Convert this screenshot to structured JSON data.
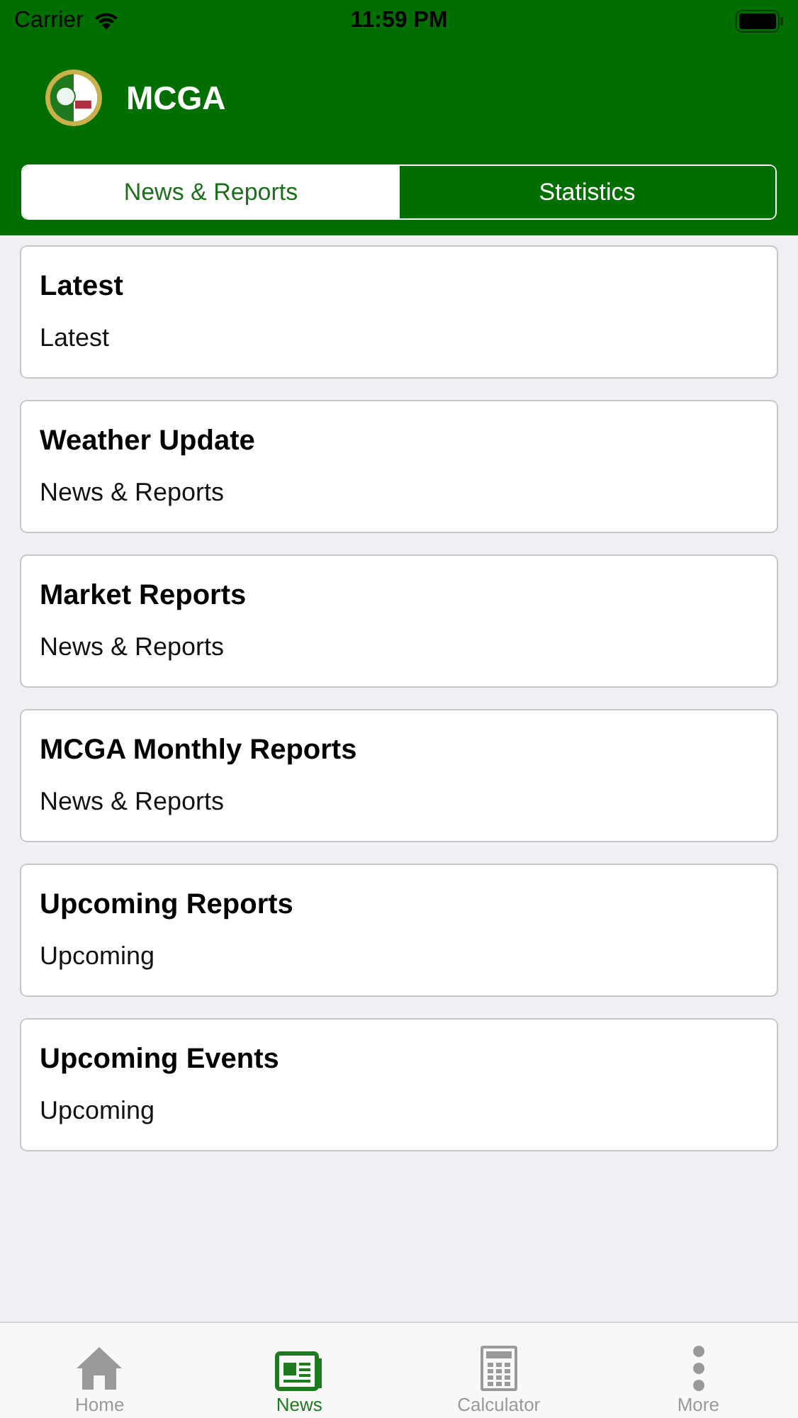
{
  "status_bar": {
    "carrier": "Carrier",
    "time": "11:59 PM"
  },
  "header": {
    "title": "MCGA"
  },
  "tabs": [
    {
      "label": "News & Reports",
      "selected": true
    },
    {
      "label": "Statistics",
      "selected": false
    }
  ],
  "cards": [
    {
      "title": "Latest",
      "subtitle": "Latest"
    },
    {
      "title": "Weather Update",
      "subtitle": "News & Reports"
    },
    {
      "title": "Market Reports",
      "subtitle": "News & Reports"
    },
    {
      "title": "MCGA Monthly Reports",
      "subtitle": "News & Reports"
    },
    {
      "title": "Upcoming Reports",
      "subtitle": "Upcoming"
    },
    {
      "title": "Upcoming Events",
      "subtitle": "Upcoming"
    }
  ],
  "tab_bar": [
    {
      "label": "Home",
      "selected": false
    },
    {
      "label": "News",
      "selected": true
    },
    {
      "label": "Calculator",
      "selected": false
    },
    {
      "label": "More",
      "selected": false
    }
  ]
}
